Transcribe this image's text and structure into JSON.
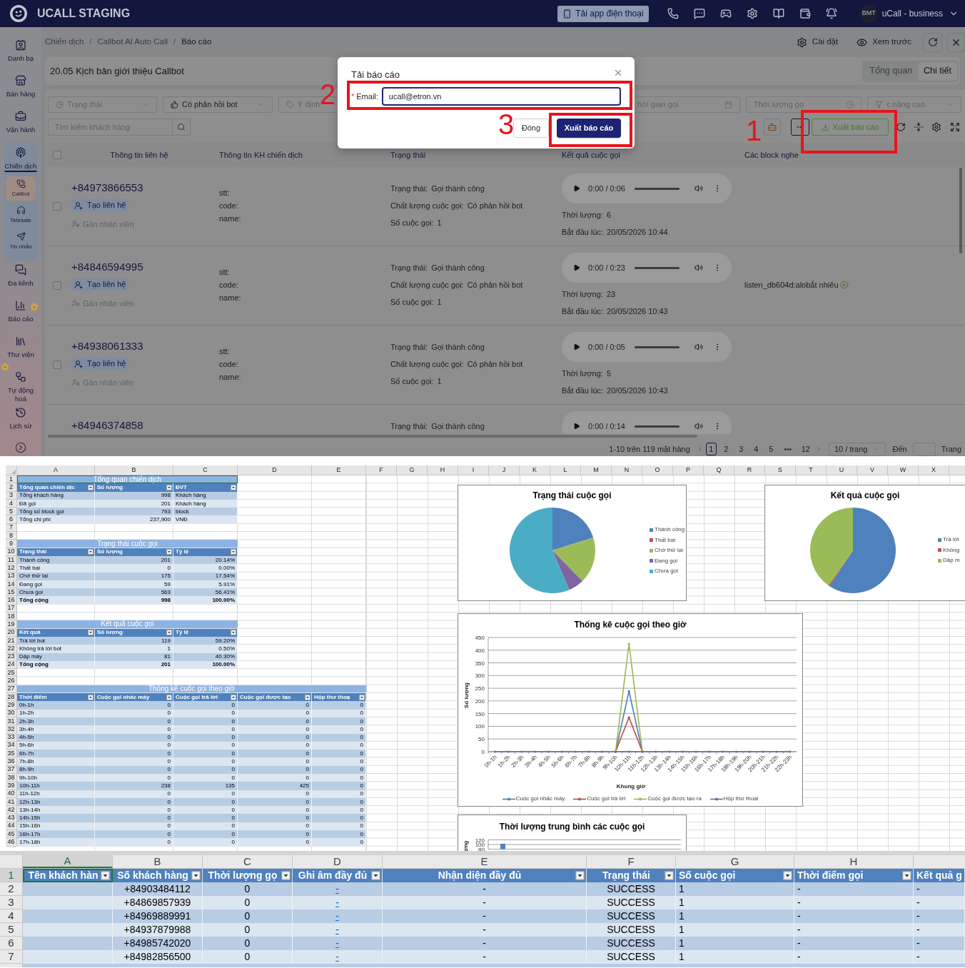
{
  "app": {
    "header": {
      "title": "UCALL STAGING",
      "download_button": "Tải app điện thoại",
      "avatar": "BMT",
      "account": "uCall - business"
    },
    "sidebar": [
      {
        "label": "Danh bạ",
        "selected": false
      },
      {
        "label": "Bán hàng",
        "selected": false
      },
      {
        "label": "Vận hành",
        "selected": false
      },
      {
        "label": "Chiến dịch",
        "selected": true,
        "children": [
          {
            "label": "Callbot",
            "selected": true
          },
          {
            "label": "Telesale",
            "selected": false
          },
          {
            "label": "Tin nhắn",
            "selected": false
          }
        ]
      },
      {
        "label": "Đa kênh",
        "selected": false
      },
      {
        "label": "Báo cáo",
        "selected": false
      },
      {
        "label": "Thư viện",
        "selected": false
      },
      {
        "label": "Tự động hoá",
        "selected": false
      },
      {
        "label": "Lịch sử",
        "selected": false
      }
    ],
    "breadcrumb": {
      "items": [
        "Chiến dịch",
        "Callbot AI Auto Call",
        "Báo cáo"
      ],
      "separator": "/"
    },
    "page_actions": [
      "Cài đặt",
      "Xem trước"
    ],
    "campaign": {
      "title": "20.05 Kịch bản giới thiệu Callbot",
      "view_tabs": [
        {
          "label": "Tổng quan",
          "selected": false
        },
        {
          "label": "Chi tiết",
          "selected": true
        }
      ]
    },
    "filters": [
      {
        "kind": "status",
        "placeholder": "Trạng thái"
      },
      {
        "kind": "feedback",
        "value": "Có phản hồi bot"
      },
      {
        "kind": "intent",
        "placeholder": "Ý định"
      },
      {
        "kind": "date",
        "placeholder": "hời gian gọi"
      },
      {
        "kind": "duration",
        "placeholder": "Thời lượng gọ"
      },
      {
        "kind": "advanced",
        "placeholder": "c nâng cao"
      }
    ],
    "search": {
      "placeholder": "Tìm kiếm khách hàng"
    },
    "export_button": "Xuất báo cáo",
    "table": {
      "select_all_checked": false,
      "columns": [
        "Thông tin liên hệ",
        "Thông tin KH chiến dịch",
        "Trạng thái",
        "Kết quả cuộc gọi",
        "Các block nghe"
      ],
      "rows": [
        {
          "checked": false,
          "phone": "+84973866553",
          "create_contact": "Tạo liên hệ",
          "assign": "Gán nhân viên",
          "fields": [
            "stt:",
            "code:",
            "name:"
          ],
          "status": [
            {
              "label": "Trạng thái:",
              "value": "Gọi thành công"
            },
            {
              "label": "Chất lượng cuộc gọi:",
              "value": "Có phản hồi bot"
            },
            {
              "label": "Số cuộc gọi:",
              "value": "1"
            }
          ],
          "audio_time": "0:00 / 0:06",
          "result": [
            {
              "label": "Thời lượng:",
              "value": "6"
            },
            {
              "label": "Bắt đầu lúc:",
              "value": "20/05/2026 10:44"
            }
          ]
        },
        {
          "checked": false,
          "phone": "+84846594995",
          "create_contact": "Tạo liên hệ",
          "assign": "Gán nhân viên",
          "fields": [
            "stt:",
            "code:",
            "name:"
          ],
          "status": [
            {
              "label": "Trạng thái:",
              "value": "Gọi thành công"
            },
            {
              "label": "Chất lượng cuộc gọi:",
              "value": "Có phản hồi bot"
            },
            {
              "label": "Số cuộc gọi:",
              "value": "1"
            }
          ],
          "audio_time": "0:00 / 0:23",
          "result": [
            {
              "label": "Thời lượng:",
              "value": "23"
            },
            {
              "label": "Bắt đầu lúc:",
              "value": "20/05/2026 10:43"
            }
          ],
          "blocks": [
            {
              "name": "listen_db604d:",
              "text": "alobắt nhiêu"
            }
          ]
        },
        {
          "checked": false,
          "phone": "+84938061333",
          "create_contact": "Tạo liên hệ",
          "assign": "Gán nhân viên",
          "fields": [
            "stt:",
            "code:",
            "name:"
          ],
          "status": [
            {
              "label": "Trạng thái:",
              "value": "Gọi thành công"
            },
            {
              "label": "Chất lượng cuộc gọi:",
              "value": "Có phản hồi bot"
            },
            {
              "label": "Số cuộc gọi:",
              "value": "1"
            }
          ],
          "audio_time": "0:00 / 0:05",
          "result": [
            {
              "label": "Thời lượng:",
              "value": "5"
            },
            {
              "label": "Bắt đầu lúc:",
              "value": "20/05/2026 10:43"
            }
          ]
        },
        {
          "phone": "+84946374858",
          "status": [
            {
              "label": "Trạng thái:",
              "value": "Gọi thành công"
            }
          ],
          "audio_time": "0:00 / 0:14"
        }
      ]
    },
    "pagination": {
      "summary": "1-10 trên 119 mặt hàng",
      "pages": [
        {
          "kind": "page",
          "label": "1",
          "selected": true
        },
        {
          "kind": "page",
          "label": "2",
          "selected": false
        },
        {
          "kind": "page",
          "label": "3",
          "selected": false
        },
        {
          "kind": "page",
          "label": "4",
          "selected": false
        },
        {
          "kind": "page",
          "label": "5",
          "selected": false
        },
        {
          "kind": "ellipsis",
          "label": "•••",
          "selected": false
        },
        {
          "kind": "page",
          "label": "12",
          "selected": false
        }
      ],
      "page_size": "10 / trang",
      "jump_label": "Đến",
      "jump_suffix": "Trang"
    },
    "modal": {
      "title": "Tải báo cáo",
      "required_mark": "*",
      "email_label": "Email:",
      "email_value": "ucall@etron.vn",
      "cancel_button": "Đóng",
      "submit_button": "Xuất báo cáo"
    },
    "annotations": [
      "2",
      "3",
      "1"
    ]
  },
  "spreadsheet": {
    "columns": [
      "A",
      "B",
      "C",
      "D",
      "E",
      "F",
      "G",
      "H",
      "I",
      "J",
      "K",
      "L",
      "M",
      "N",
      "O",
      "P",
      "Q",
      "R",
      "S",
      "T",
      "U",
      "V",
      "W",
      "X"
    ],
    "row_numbers": [
      "1",
      "2",
      "3",
      "4",
      "5",
      "6",
      "7",
      "8",
      "9",
      "10",
      "11",
      "12",
      "13",
      "14",
      "15",
      "16",
      "17",
      "18",
      "19",
      "20",
      "21",
      "22",
      "23",
      "24",
      "25",
      "26",
      "27",
      "28",
      "29",
      "30",
      "31",
      "32",
      "33",
      "34",
      "35",
      "36",
      "37",
      "38",
      "39",
      "40",
      "41",
      "42",
      "43",
      "44",
      "45",
      "46"
    ],
    "tables": [
      {
        "kind": "units",
        "selected": true,
        "title": "Tổng quan chiến dịch",
        "columns": [
          "Tổng quan chiến dịc",
          "Số lượng",
          "ĐVT"
        ],
        "rows": [
          [
            "Tổng khách hàng",
            "998",
            "Khách hàng"
          ],
          [
            "Đã gọi",
            "201",
            "Khách hàng"
          ],
          [
            "Tổng số block gọi",
            "793",
            "block"
          ],
          [
            "Tổng chi phí",
            "237,900",
            "VNĐ"
          ]
        ]
      },
      {
        "kind": "stats",
        "selected": false,
        "title": "Trạng thái cuộc gọi",
        "columns": [
          "Trạng thái",
          "Số lượng",
          "Tỷ lệ"
        ],
        "rows": [
          [
            "Thành công",
            "201",
            "20.14%"
          ],
          [
            "Thất bại",
            "0",
            "0.00%"
          ],
          [
            "Chờ thử lại",
            "175",
            "17.54%"
          ],
          [
            "Đang gọi",
            "59",
            "5.91%"
          ],
          [
            "Chưa gọi",
            "563",
            "56.41%"
          ]
        ],
        "total": [
          "Tổng cộng",
          "998",
          "100.00%"
        ]
      },
      {
        "kind": "stats",
        "selected": false,
        "title": "Kết quả cuộc gọi",
        "columns": [
          "Kết quả",
          "Số lượng",
          "Tỷ lệ"
        ],
        "rows": [
          [
            "Trả lời bot",
            "119",
            "59.20%"
          ],
          [
            "Không trả lời bot",
            "1",
            "0.50%"
          ],
          [
            "Dập máy",
            "81",
            "40.30%"
          ]
        ],
        "total": [
          "Tổng cộng",
          "201",
          "100.00%"
        ]
      },
      {
        "kind": "stats",
        "selected": false,
        "title": "Thống kê cuộc gọi theo giờ",
        "columns": [
          "Thời điểm",
          "Cuộc gọi nhấc máy",
          "Cuộc gọi trả lời",
          "Cuộc gọi được tạo",
          "Hộp thư thoạ"
        ],
        "rows": [
          [
            "0h-1h",
            "0",
            "0",
            "0",
            "0"
          ],
          [
            "1h-2h",
            "0",
            "0",
            "0",
            "0"
          ],
          [
            "2h-3h",
            "0",
            "0",
            "0",
            "0"
          ],
          [
            "3h-4h",
            "0",
            "0",
            "0",
            "0"
          ],
          [
            "4h-5h",
            "0",
            "0",
            "0",
            "0"
          ],
          [
            "5h-6h",
            "0",
            "0",
            "0",
            "0"
          ],
          [
            "6h-7h",
            "0",
            "0",
            "0",
            "0"
          ],
          [
            "7h-8h",
            "0",
            "0",
            "0",
            "0"
          ],
          [
            "8h-9h",
            "0",
            "0",
            "0",
            "0"
          ],
          [
            "9h-10h",
            "0",
            "0",
            "0",
            "0"
          ],
          [
            "10h-11h",
            "238",
            "135",
            "425",
            "0"
          ],
          [
            "11h-12h",
            "0",
            "0",
            "0",
            "0"
          ],
          [
            "12h-13h",
            "0",
            "0",
            "0",
            "0"
          ],
          [
            "13h-14h",
            "0",
            "0",
            "0",
            "0"
          ],
          [
            "14h-15h",
            "0",
            "0",
            "0",
            "0"
          ],
          [
            "15h-16h",
            "0",
            "0",
            "0",
            "0"
          ],
          [
            "16h-17h",
            "0",
            "0",
            "0",
            "0"
          ],
          [
            "17h-18h",
            "0",
            "0",
            "0",
            "0"
          ]
        ]
      }
    ],
    "charts": [
      {
        "chart_data": {
          "type": "pie",
          "title": "Trạng thái cuộc gọi",
          "categories": [
            "Thành công",
            "Thất bại",
            "Chờ thử lại",
            "Đang gọi",
            "Chưa gọi"
          ],
          "values": [
            20.14,
            0,
            17.54,
            5.91,
            56.41
          ],
          "legend": "right"
        }
      },
      {
        "chart_data": {
          "type": "pie",
          "title": "Kết quả cuộc gọi",
          "categories": [
            "Trả lời",
            "Không",
            "Dập m"
          ],
          "values": [
            59.2,
            0.5,
            40.3
          ],
          "legend": "right"
        }
      },
      {
        "chart_data": {
          "type": "line",
          "title": "Thống kê cuộc gọi theo giờ",
          "xlabel": "Khung giờ",
          "ylabel": "Số lượng",
          "categories": [
            "0h-1h",
            "1h-2h",
            "2h-3h",
            "3h-4h",
            "4h-5h",
            "5h-6h",
            "6h-7h",
            "7h-8h",
            "8h-9h",
            "9h-10h",
            "10h-11h",
            "11h-12h",
            "12h-13h",
            "13h-14h",
            "14h-15h",
            "15h-16h",
            "16h-17h",
            "17h-18h",
            "18h-19h",
            "19h-20h",
            "20h-21h",
            "21h-22h",
            "22h-23h"
          ],
          "ylim": [
            0,
            450
          ],
          "yticks": [
            0,
            50,
            100,
            150,
            200,
            250,
            300,
            350,
            400,
            450
          ],
          "grid": true,
          "legend": "bottom",
          "series": [
            {
              "name": "Cuộc gọi nhấc máy",
              "color": "#4a7ebb",
              "values": [
                null,
                null,
                null,
                null,
                null,
                null,
                null,
                null,
                null,
                0,
                238,
                0,
                null,
                null,
                null,
                null,
                null,
                null,
                null,
                null,
                null,
                null,
                null
              ]
            },
            {
              "name": "Cuộc gọi trả lời",
              "color": "#be4b48",
              "values": [
                null,
                null,
                null,
                null,
                null,
                null,
                null,
                null,
                null,
                0,
                135,
                0,
                null,
                null,
                null,
                null,
                null,
                null,
                null,
                null,
                null,
                null,
                null
              ]
            },
            {
              "name": "Cuộc gọi được tạo ra",
              "color": "#98b954",
              "values": [
                null,
                null,
                null,
                null,
                null,
                null,
                null,
                null,
                null,
                0,
                425,
                0,
                null,
                null,
                null,
                null,
                null,
                null,
                null,
                null,
                null,
                null,
                null
              ]
            },
            {
              "name": "Hộp thư thoại",
              "color": "#7d60a0",
              "values": [
                0,
                0,
                0,
                0,
                0,
                0,
                0,
                0,
                0,
                0,
                0,
                0,
                0,
                0,
                0,
                0,
                0,
                0,
                0,
                0,
                0,
                0,
                0
              ]
            }
          ]
        }
      },
      {
        "chart_data": {
          "type": "bar",
          "title": "Thời lượng trung bình các cuộc gọi",
          "ylabel": "ợng",
          "ylim": [
            80,
            120
          ],
          "yticks": [
            80,
            100,
            120
          ],
          "grid": true,
          "values": [
            103
          ]
        }
      }
    ]
  },
  "export_sheet": {
    "columns": [
      {
        "label": "A",
        "selected": true
      },
      {
        "label": "B",
        "selected": false
      },
      {
        "label": "C",
        "selected": false
      },
      {
        "label": "D",
        "selected": false
      },
      {
        "label": "E",
        "selected": false
      },
      {
        "label": "F",
        "selected": false
      },
      {
        "label": "G",
        "selected": false
      },
      {
        "label": "H",
        "selected": false
      }
    ],
    "row_numbers": [
      {
        "label": "1",
        "selected": true
      },
      {
        "label": "2",
        "selected": false
      },
      {
        "label": "3",
        "selected": false
      },
      {
        "label": "4",
        "selected": false
      },
      {
        "label": "5",
        "selected": false
      },
      {
        "label": "6",
        "selected": false
      },
      {
        "label": "7",
        "selected": false
      }
    ],
    "header": [
      "Tên khách hàn",
      "Số khách hàng",
      "Thời lượng gọ",
      "Ghi âm đầy đủ",
      "Nhận diện đầy đủ",
      "Trạng thái",
      "Số cuộc gọi",
      "Thời điểm gọi",
      "Kết quả g"
    ],
    "rows": [
      {
        "phone": "+84903484112",
        "duration": "0",
        "recording": "-",
        "recognition": "-",
        "status": "SUCCESS",
        "call_count": "1",
        "call_time": "-",
        "result": "-"
      },
      {
        "phone": "+84869857939",
        "duration": "0",
        "recording": "-",
        "recognition": "-",
        "status": "SUCCESS",
        "call_count": "1",
        "call_time": "-",
        "result": "-"
      },
      {
        "phone": "+84969889991",
        "duration": "0",
        "recording": "-",
        "recognition": "-",
        "status": "SUCCESS",
        "call_count": "1",
        "call_time": "-",
        "result": "-"
      },
      {
        "phone": "+84937879988",
        "duration": "0",
        "recording": "-",
        "recognition": "-",
        "status": "SUCCESS",
        "call_count": "1",
        "call_time": "-",
        "result": "-"
      },
      {
        "phone": "+84985742020",
        "duration": "0",
        "recording": "-",
        "recognition": "-",
        "status": "SUCCESS",
        "call_count": "1",
        "call_time": "-",
        "result": "-"
      },
      {
        "phone": "+84982856500",
        "duration": "0",
        "recording": "-",
        "recognition": "-",
        "status": "SUCCESS",
        "call_count": "1",
        "call_time": "-",
        "result": "-"
      }
    ]
  }
}
